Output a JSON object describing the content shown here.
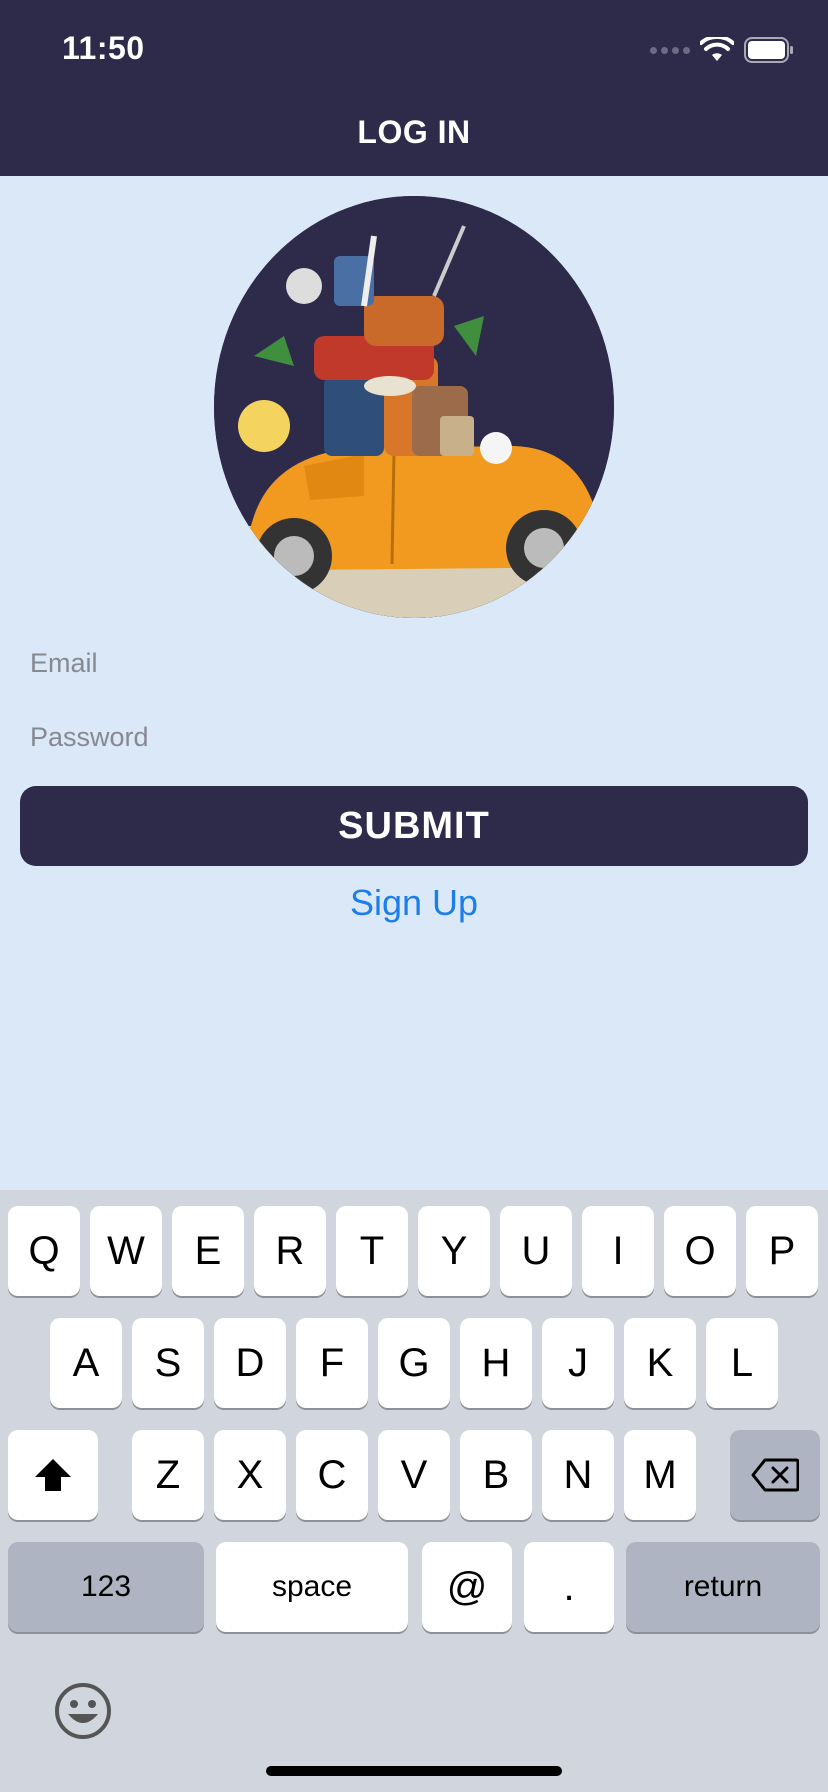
{
  "status_bar": {
    "time": "11:50"
  },
  "nav": {
    "title": "LOG IN"
  },
  "form": {
    "email_placeholder": "Email",
    "password_placeholder": "Password",
    "submit_label": "SUBMIT",
    "signup_label": "Sign Up"
  },
  "keyboard": {
    "row1": [
      "Q",
      "W",
      "E",
      "R",
      "T",
      "Y",
      "U",
      "I",
      "O",
      "P"
    ],
    "row2": [
      "A",
      "S",
      "D",
      "F",
      "G",
      "H",
      "J",
      "K",
      "L"
    ],
    "row3": [
      "Z",
      "X",
      "C",
      "V",
      "B",
      "N",
      "M"
    ],
    "row4": {
      "numbers": "123",
      "space": "space",
      "at": "@",
      "dot": ".",
      "return": "return"
    }
  },
  "icons": [
    "wifi-icon",
    "battery-icon",
    "shift-icon",
    "backspace-icon",
    "emoji-icon"
  ],
  "colors": {
    "header_bg": "#2e2a4a",
    "page_bg": "#dbe8f7",
    "link": "#1c7ee8",
    "car": "#f29a1f"
  }
}
